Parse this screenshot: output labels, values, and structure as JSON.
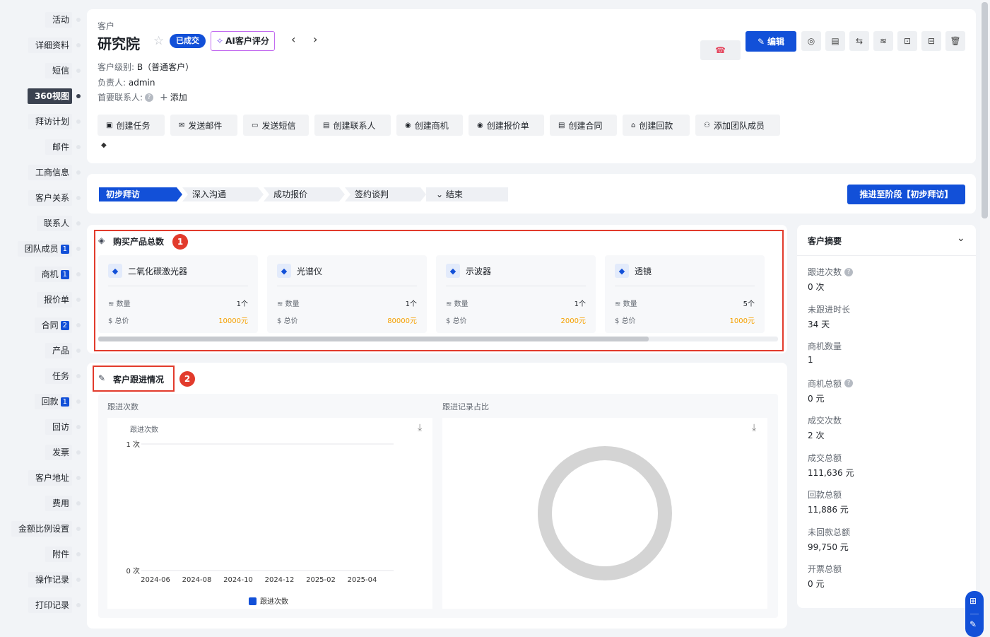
{
  "nav": [
    {
      "label": "活动"
    },
    {
      "label": "详细资料"
    },
    {
      "label": "短信"
    },
    {
      "label": "360视图",
      "active": true
    },
    {
      "label": "拜访计划"
    },
    {
      "label": "邮件"
    },
    {
      "label": "工商信息"
    },
    {
      "label": "客户关系"
    },
    {
      "label": "联系人"
    },
    {
      "label": "团队成员",
      "badge": "1"
    },
    {
      "label": "商机",
      "badge": "1"
    },
    {
      "label": "报价单"
    },
    {
      "label": "合同",
      "badge": "2"
    },
    {
      "label": "产品"
    },
    {
      "label": "任务"
    },
    {
      "label": "回款",
      "badge": "1"
    },
    {
      "label": "回访"
    },
    {
      "label": "发票"
    },
    {
      "label": "客户地址"
    },
    {
      "label": "费用"
    },
    {
      "label": "金额比例设置"
    },
    {
      "label": "附件"
    },
    {
      "label": "操作记录"
    },
    {
      "label": "打印记录"
    }
  ],
  "header": {
    "breadcrumb": "客户",
    "title": "研究院",
    "status_badge": "已成交",
    "ai_button": "AI客户评分",
    "level_label": "客户级别:",
    "level_value": "B（普通客户）",
    "owner_label": "负责人:",
    "owner_value": "admin",
    "contact_label": "首要联系人:",
    "add_label": "添加",
    "edit_button": "编辑"
  },
  "actions": [
    "创建任务",
    "发送邮件",
    "发送短信",
    "创建联系人",
    "创建商机",
    "创建报价单",
    "创建合同",
    "创建回款",
    "添加团队成员"
  ],
  "stages": [
    "初步拜访",
    "深入沟通",
    "成功报价",
    "签约谈判",
    "结束"
  ],
  "advance_button": "推进至阶段【初步拜访】",
  "products_section": {
    "title": "购买产品总数",
    "qty_label": "数量",
    "total_label": "总价",
    "items": [
      {
        "name": "二氧化碳激光器",
        "qty": "1个",
        "price": "10000元"
      },
      {
        "name": "光谱仪",
        "qty": "1个",
        "price": "80000元"
      },
      {
        "name": "示波器",
        "qty": "1个",
        "price": "2000元"
      },
      {
        "name": "透镜",
        "qty": "5个",
        "price": "1000元"
      }
    ],
    "scroll_fraction": 0.81
  },
  "followup_section": {
    "title": "客户跟进情况",
    "count_chart_title": "跟进次数",
    "ratio_chart_title": "跟进记录占比"
  },
  "chart_data": [
    {
      "type": "line",
      "title": "跟进次数",
      "ylabel": "跟进次数",
      "x": [
        "2024-06",
        "2024-08",
        "2024-10",
        "2024-12",
        "2025-02",
        "2025-04"
      ],
      "yticks": [
        "0 次",
        "1 次"
      ],
      "ylim": [
        0,
        1
      ],
      "series": [
        {
          "name": "跟进次数",
          "values": []
        }
      ],
      "legend": "bottom",
      "color": "#1250d8"
    },
    {
      "type": "pie",
      "title": "跟进记录占比",
      "series": [],
      "color": "#d4d4d4"
    }
  ],
  "summary": {
    "title": "客户摘要",
    "items": [
      {
        "label": "跟进次数",
        "value": "0 次",
        "help": true
      },
      {
        "label": "未跟进时长",
        "value": "34 天"
      },
      {
        "label": "商机数量",
        "value": "1"
      },
      {
        "label": "商机总额",
        "value": "0 元",
        "help": true
      },
      {
        "label": "成交次数",
        "value": "2 次"
      },
      {
        "label": "成交总额",
        "value": "111,636 元"
      },
      {
        "label": "回款总额",
        "value": "11,886 元"
      },
      {
        "label": "未回款总额",
        "value": "99,750 元"
      },
      {
        "label": "开票总额",
        "value": "0 元"
      }
    ]
  },
  "annotations": [
    "1",
    "2"
  ],
  "colors": {
    "primary": "#1250d8",
    "warning": "#f5a000",
    "highlight": "#e23b2c"
  }
}
